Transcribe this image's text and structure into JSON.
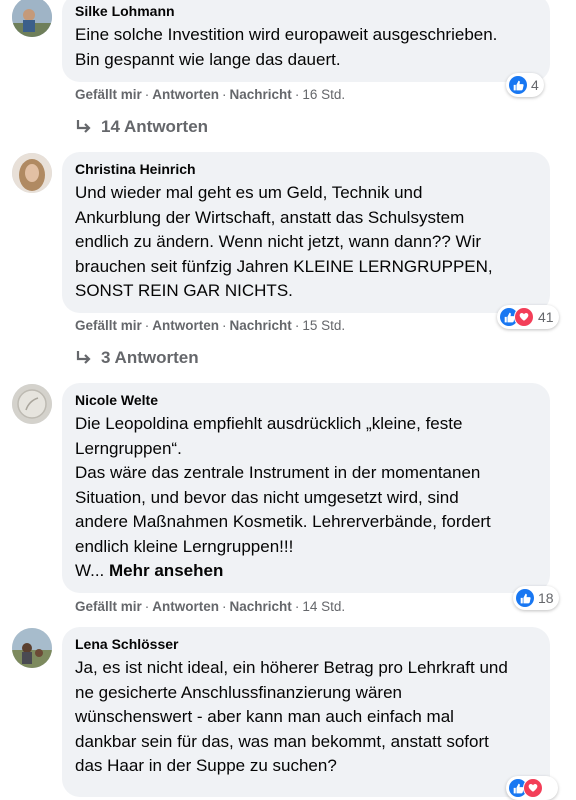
{
  "comments": [
    {
      "author": "Silke Lohmann",
      "lines": [
        "Eine solche Investition wird europaweit ausgeschrieben.",
        "Bin gespannt wie lange das dauert."
      ],
      "reaction_count": "4",
      "time": "16 Std.",
      "replies_label": "14 Antworten"
    },
    {
      "author": "Christina Heinrich",
      "lines": [
        "Und wieder mal geht es um Geld, Technik und",
        "Ankurblung der Wirtschaft, anstatt das Schulsystem",
        "endlich zu ändern. Wenn nicht jetzt, wann dann?? Wir",
        "brauchen seit fünfzig Jahren KLEINE LERNGRUPPEN,",
        "SONST REIN GAR NICHTS."
      ],
      "reaction_count": "41",
      "time": "15 Std.",
      "replies_label": "3 Antworten"
    },
    {
      "author": "Nicole Welte",
      "lines": [
        "Die Leopoldina empfiehlt ausdrücklich „kleine, feste",
        "Lerngruppen“.",
        "Das wäre das zentrale Instrument in der momentanen",
        "Situation, und bevor das nicht umgesetzt wird, sind",
        "andere Maßnahmen Kosmetik. Lehrerverbände, fordert",
        "endlich kleine Lerngruppen!!!"
      ],
      "truncated_prefix": "W...",
      "more_label": "Mehr ansehen",
      "reaction_count": "18",
      "time": "14 Std."
    },
    {
      "author": "Lena Schlösser",
      "lines": [
        "Ja, es ist nicht ideal, ein höherer Betrag pro Lehrkraft und",
        "ne gesicherte Anschlussfinanzierung wären",
        "wünschenswert - aber kann man auch einfach mal",
        "dankbar sein für das, was man bekommt, anstatt sofort",
        "das Haar in der Suppe zu suchen?"
      ]
    }
  ],
  "actions": {
    "like": "Gefällt mir",
    "reply": "Antworten",
    "message": "Nachricht",
    "separator": "·"
  },
  "colors": {
    "bubble": "#f0f2f5",
    "secondary_text": "#65676b",
    "like_blue": "#1877f2",
    "love_red": "#f33e58"
  },
  "icons": [
    "like-reaction-icon",
    "love-reaction-icon",
    "reply-arrow-icon"
  ]
}
